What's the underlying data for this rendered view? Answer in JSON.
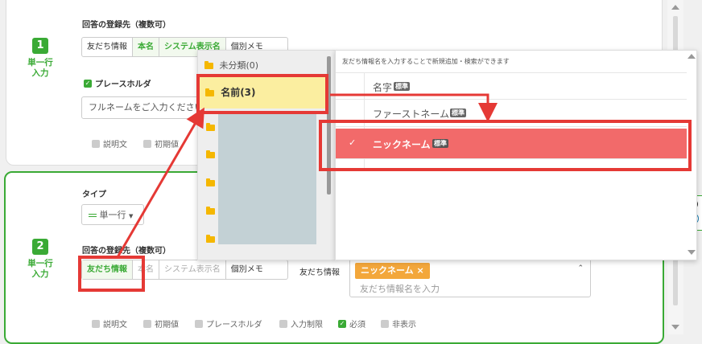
{
  "card1": {
    "number": "1",
    "type_line1": "単一行",
    "type_line2": "入力",
    "dest_label": "回答の登録先（複数可）",
    "dest_tabs": [
      "友だち情報",
      "本名",
      "システム表示名",
      "個別メモ"
    ],
    "placeholder_check_label": "プレースホルダ",
    "placeholder_value": "フルネームをご入力ください",
    "options": [
      "説明文",
      "初期値"
    ]
  },
  "card2": {
    "number": "2",
    "type_line1": "単一行",
    "type_line2": "入力",
    "type_label": "タイプ",
    "type_select": "単一行",
    "dest_label": "回答の登録先（複数可）",
    "dest_tabs": [
      "友だち情報",
      "本名",
      "システム表示名",
      "個別メモ"
    ],
    "friend_info_label": "友だち情報",
    "selected_tag": "ニックネーム ×",
    "tag_search_placeholder": "友だち情報名を入力",
    "options": [
      "説明文",
      "初期値",
      "プレースホルダ",
      "入力制限",
      "必須",
      "非表示"
    ]
  },
  "dropdown": {
    "folders": [
      "未分類(0)",
      "名前(3)"
    ],
    "hint": "友だち情報名を入力することで新規追加・検索ができます",
    "items": [
      {
        "name": "名字",
        "badge": "標準"
      },
      {
        "name": "ファーストネーム",
        "badge": "標準"
      },
      {
        "name": "ニックネーム",
        "badge": "標準",
        "check": "✓"
      }
    ]
  },
  "colors": {
    "accent": "#3aaa35",
    "highlight_row": "#f26a6a",
    "annotation": "#e53935",
    "folder_selected": "#fbeea0"
  },
  "icons": [
    "folder-icon",
    "checkbox-icon",
    "close-icon",
    "chevron-up-icon",
    "scroll-up-icon",
    "scroll-down-icon",
    "line-type-icon",
    "side-e-icon"
  ]
}
